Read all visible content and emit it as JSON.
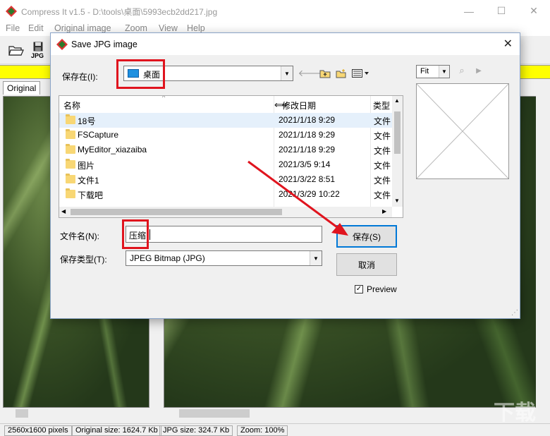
{
  "window": {
    "title": "Compress It v1.5 - D:\\tools\\桌面\\5993ecb2dd217.jpg",
    "controls": {
      "minimize": "—",
      "maximize": "☐",
      "close": "✕"
    }
  },
  "menu": [
    "File",
    "Edit",
    "Original image",
    "Zoom",
    "View",
    "Help"
  ],
  "toolbar": {
    "jpg_label": "JPG"
  },
  "panes": {
    "original_tab": "Original"
  },
  "status": {
    "dimensions": "2560x1600 pixels",
    "original_size": "Original size: 1624.7 Kb",
    "jpg_size": "JPG size: 324.7 Kb",
    "zoom": "Zoom: 100%"
  },
  "dialog": {
    "title": "Save JPG image",
    "close": "✕",
    "save_in_label": "保存在(I):",
    "save_in_value": "桌面",
    "columns": {
      "name": "名称",
      "modified": "修改日期",
      "type": "类型"
    },
    "files": [
      {
        "name": "18号",
        "date": "2021/1/18 9:29",
        "type": "文件"
      },
      {
        "name": "FSCapture",
        "date": "2021/1/18 9:29",
        "type": "文件"
      },
      {
        "name": "MyEditor_xiazaiba",
        "date": "2021/1/18 9:29",
        "type": "文件"
      },
      {
        "name": "图片",
        "date": "2021/3/5 9:14",
        "type": "文件"
      },
      {
        "name": "文件1",
        "date": "2021/3/22 8:51",
        "type": "文件"
      },
      {
        "name": "下载吧",
        "date": "2021/3/29 10:22",
        "type": "文件"
      }
    ],
    "filename_label": "文件名(N):",
    "filename_value": "压缩",
    "filetype_label": "保存类型(T):",
    "filetype_value": "JPEG Bitmap (JPG)",
    "save_button": "保存(S)",
    "cancel_button": "取消",
    "preview_label": "Preview",
    "preview_checked": true,
    "fit_value": "Fit"
  },
  "watermark": "下载吧",
  "colors": {
    "accent": "#0078d7",
    "highlight": "#e0141e",
    "yellow": "#ffff00",
    "selection": "#e5f0fb"
  }
}
